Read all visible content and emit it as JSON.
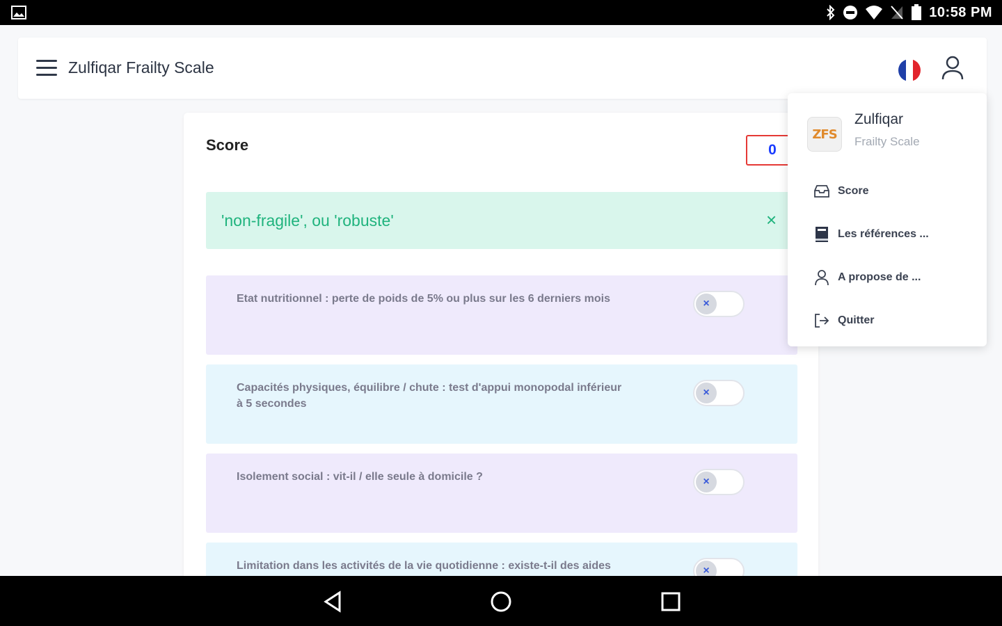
{
  "status_bar": {
    "time": "10:58 PM"
  },
  "header": {
    "title": "Zulfiqar Frailty Scale"
  },
  "score": {
    "label": "Score",
    "value": "0"
  },
  "alert": {
    "text": "'non-fragile', ou 'robuste'",
    "close": "×"
  },
  "questions": [
    {
      "text": "Etat nutritionnel : perte de poids de 5% ou plus sur les 6 derniers mois",
      "toggle_mark": "×"
    },
    {
      "text": "Capacités physiques, équilibre / chute : test d'appui monopodal inférieur à 5 secondes",
      "toggle_mark": "×"
    },
    {
      "text": "Isolement social : vit-il / elle seule à domicile ?",
      "toggle_mark": "×"
    },
    {
      "text": "Limitation dans les activités de la vie quotidienne : existe-t-il des aides",
      "toggle_mark": "×"
    }
  ],
  "menu": {
    "logo_text": "ZFS",
    "name": "Zulfiqar",
    "subtitle": "Frailty Scale",
    "items": [
      {
        "label": "Score",
        "icon": "inbox-icon"
      },
      {
        "label": "Les références ...",
        "icon": "book-icon"
      },
      {
        "label": "A propose de ...",
        "icon": "user-icon"
      },
      {
        "label": "Quitter",
        "icon": "logout-icon"
      }
    ]
  },
  "colors": {
    "alert_bg": "#d9f6ec",
    "alert_text": "#1fb37d",
    "score_border": "#e53935",
    "score_value": "#1a3cff",
    "purple_row": "#efeafc",
    "blue_row": "#e6f6fd"
  }
}
